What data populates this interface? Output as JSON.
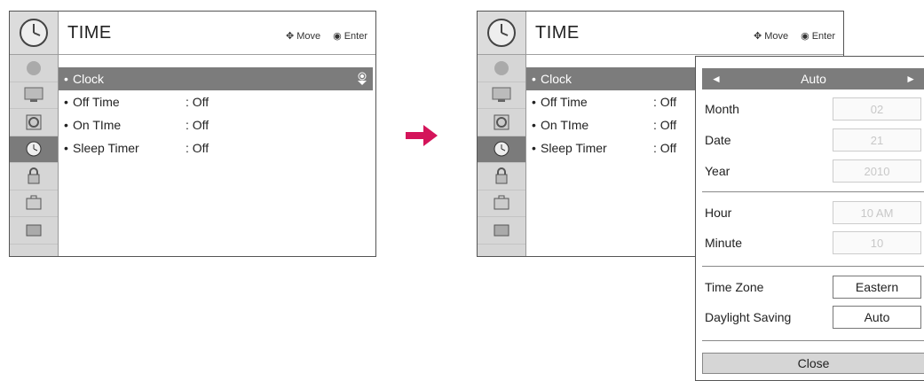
{
  "screen": {
    "title": "TIME",
    "hint_move": "Move",
    "hint_enter": "Enter",
    "menu": [
      {
        "bullet": "•",
        "label": "Clock",
        "value": ""
      },
      {
        "bullet": "•",
        "label": "Off Time",
        "value": ": Off"
      },
      {
        "bullet": "•",
        "label": "On TIme",
        "value": ": Off"
      },
      {
        "bullet": "•",
        "label": "Sleep Timer",
        "value": ": Off"
      }
    ],
    "sidebar_icons": [
      "satellite-dish-icon",
      "tv-screen-icon",
      "speaker-icon",
      "clock-icon",
      "lock-icon",
      "toolbox-icon",
      "usb-photo-icon"
    ],
    "active_sidebar_index": 3
  },
  "popup": {
    "mode_left_arrow": "◄",
    "mode_value": "Auto",
    "mode_right_arrow": "►",
    "month_label": "Month",
    "month_value": "02",
    "date_label": "Date",
    "date_value": "21",
    "year_label": "Year",
    "year_value": "2010",
    "hour_label": "Hour",
    "hour_value": "10 AM",
    "minute_label": "Minute",
    "minute_value": "10",
    "timezone_label": "Time Zone",
    "timezone_value": "Eastern",
    "daylight_label": "Daylight Saving",
    "daylight_value": "Auto",
    "close_label": "Close"
  },
  "colors": {
    "arrow": "#d4145a",
    "highlight": "#7c7c7c",
    "sidebar": "#d6d6d6"
  }
}
